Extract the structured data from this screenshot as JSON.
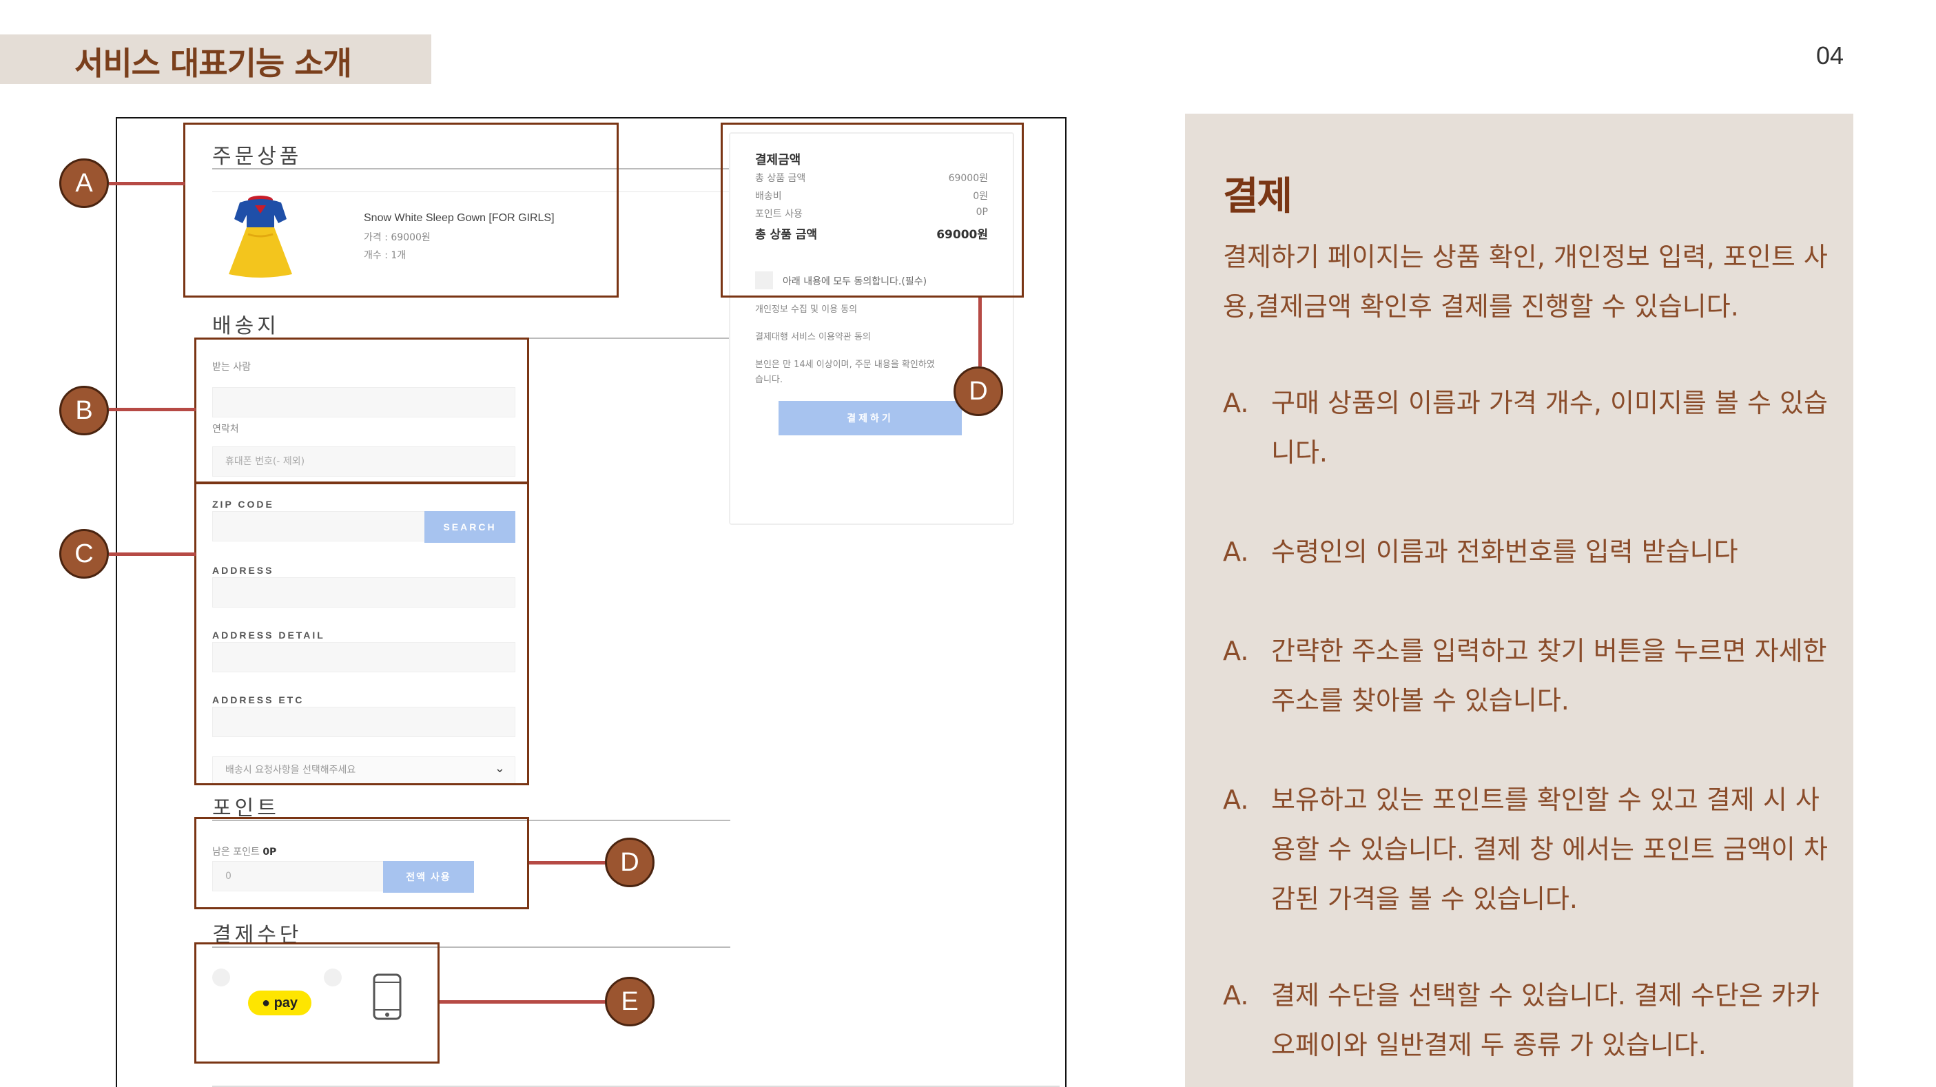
{
  "header": {
    "title": "서비스 대표기능 소개",
    "page_number": "04"
  },
  "order": {
    "section_title": "주문상품",
    "product_name": "Snow White Sleep Gown [FOR GIRLS]",
    "price": "가격 : 69000원",
    "count": "개수 : 1개"
  },
  "shipping": {
    "section_title": "배송지",
    "recipient_label": "받는 사람",
    "contact_label": "연락처",
    "phone_placeholder": "휴대폰 번호(- 제외)",
    "zip_label": "ZIP CODE",
    "search_button": "SEARCH",
    "address_label": "ADDRESS",
    "address_detail_label": "ADDRESS DETAIL",
    "address_etc_label": "ADDRESS ETC",
    "request_select": "배송시 요청사항을 선택해주세요"
  },
  "points": {
    "section_title": "포인트",
    "remaining_label": "남은 포인트",
    "remaining_value": "0P",
    "input_value": "0",
    "use_all_button": "전액 사용"
  },
  "payment_method": {
    "section_title": "결제수단",
    "kakaopay_label": "pay"
  },
  "summary": {
    "title": "결제금액",
    "rows": [
      {
        "label": "총 상품 금액",
        "value": "69000원"
      },
      {
        "label": "배송비",
        "value": "0원"
      },
      {
        "label": "포인트 사용",
        "value": "0P"
      }
    ],
    "total_label": "총 상품 금액",
    "total_value": "69000원",
    "agree_all": "아래 내용에 모두 동의합니다.(필수)",
    "terms1": "개인정보 수집 및 이용 동의",
    "terms2": "결제대행 서비스 이용약관 동의",
    "terms3_line1": "본인은 만 14세 이상이며, 주문 내용을 확인하였",
    "terms3_line2": "습니다.",
    "pay_button": "결제하기"
  },
  "markers": {
    "a": "A",
    "b": "B",
    "c": "C",
    "d1": "D",
    "d2": "D",
    "e": "E"
  },
  "description": {
    "title": "결제",
    "intro": " 결제하기 페이지는 상품 확인, 개인정보 입력, 포인트 사용,결제금액 확인후 결제를 진행할 수 있습니다.",
    "items": [
      {
        "letter": "A.",
        "text": "구매 상품의 이름과 가격 개수, 이미지를 볼 수 있습니다."
      },
      {
        "letter": "A.",
        "text": "수령인의 이름과 전화번호를 입력 받습니다"
      },
      {
        "letter": "A.",
        "text": "간략한 주소를 입력하고 찾기 버튼을 누르면 자세한 주소를 찾아볼 수 있습니다."
      },
      {
        "letter": "A.",
        "text": "보유하고 있는 포인트를 확인할 수 있고 결제 시 사용할 수 있습니다.  결제 창 에서는 포인트 금액이 차감된 가격을 볼 수 있습니다."
      },
      {
        "letter": "A.",
        "text": "결제 수단을 선택할 수 있습니다. 결제 수단은 카카오페이와 일반결제 두 종류 가 있습니다."
      }
    ]
  },
  "colors": {
    "accent_brown": "#7a3614",
    "marker_fill": "#9b5530",
    "connector_red": "#b64a45",
    "panel_bg": "#e6dfd8",
    "button_blue": "#a7c3ef"
  }
}
